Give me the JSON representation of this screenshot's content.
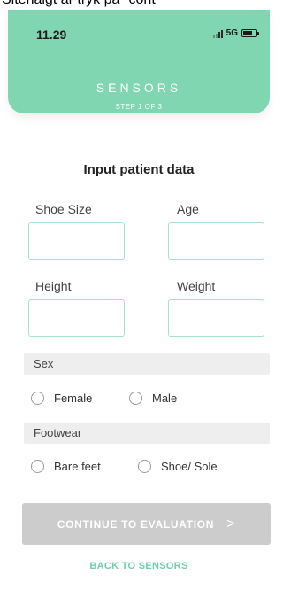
{
  "caption": "Sitenaigt är tryk på \"cont",
  "status_bar": {
    "time": "11.29",
    "network": "5G"
  },
  "header": {
    "title": "SENSORS",
    "step": "STEP 1 OF 3"
  },
  "form": {
    "title": "Input patient data",
    "fields": {
      "shoe_size": {
        "label": "Shoe Size",
        "value": ""
      },
      "age": {
        "label": "Age",
        "value": ""
      },
      "height": {
        "label": "Height",
        "value": ""
      },
      "weight": {
        "label": "Weight",
        "value": ""
      }
    },
    "sex": {
      "label": "Sex",
      "options": [
        "Female",
        "Male"
      ],
      "selected": null
    },
    "footwear": {
      "label": "Footwear",
      "options": [
        "Bare feet",
        "Shoe/ Sole"
      ],
      "selected": null
    }
  },
  "actions": {
    "continue_label": "CONTINUE TO EVALUATION",
    "continue_chevron": ">",
    "back_label": "BACK TO SENSORS"
  },
  "colors": {
    "accent": "#7fd6b0",
    "input_border": "#a8e0c8",
    "disabled_button": "#cccccc",
    "link": "#6fcfa6"
  }
}
